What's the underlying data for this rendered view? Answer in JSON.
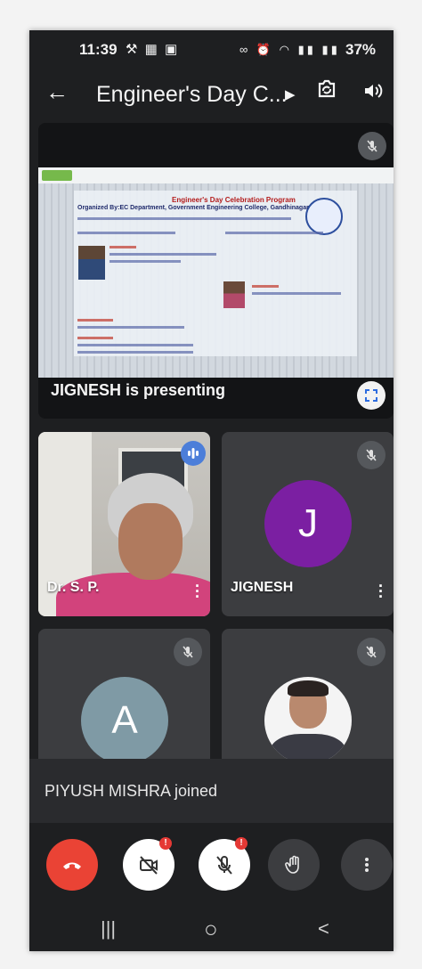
{
  "status_bar": {
    "time": "11:39",
    "battery": "37%"
  },
  "app_bar": {
    "title": "Engineer's Day C..."
  },
  "presentation": {
    "caption": "JIGNESH is presenting",
    "slide": {
      "title": "Engineer's Day Celebration Program",
      "subtitle": "Organized By:EC Department, Government Engineering College, Gandhinagar"
    }
  },
  "participants": [
    {
      "name": "Dr. S. P.",
      "type": "video"
    },
    {
      "name": "JIGNESH",
      "initial": "J",
      "avatar_color": "#7b1fa2"
    },
    {
      "initial": "A",
      "avatar_color": "#7f9aa5"
    },
    {
      "type": "photo"
    }
  ],
  "toast": {
    "message": "PIYUSH MISHRA joined"
  },
  "controls": {
    "end_call_color": "#ea4335",
    "badge_text": "!"
  },
  "nav": {
    "recents": "|||",
    "home": "○",
    "back": "<"
  }
}
